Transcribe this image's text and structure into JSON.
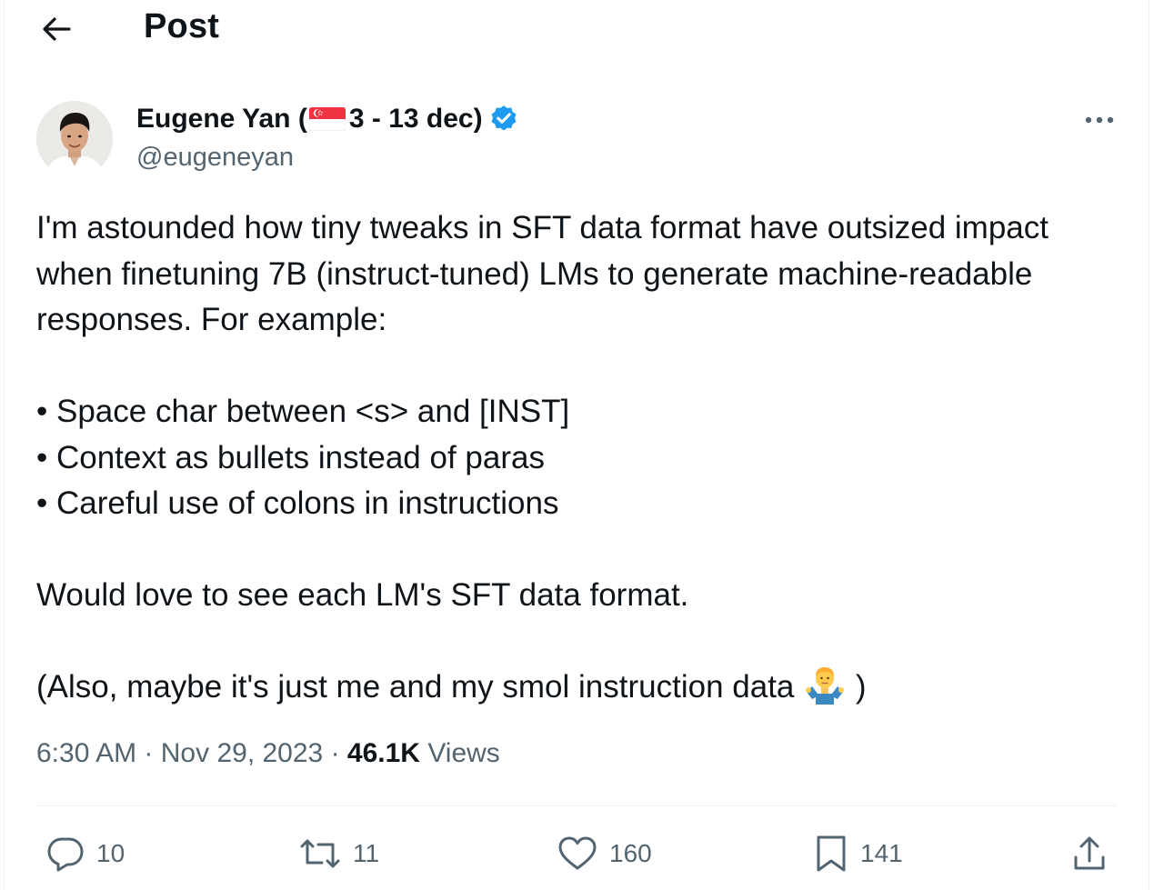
{
  "header": {
    "back_icon": "arrow-left-icon",
    "title": "Post"
  },
  "author": {
    "name_prefix": "Eugene Yan (",
    "flag_icon": "singapore-flag-icon",
    "name_suffix": "3 - 13 dec)",
    "verified_icon": "verified-badge-icon",
    "handle": "@eugeneyan",
    "more_icon": "more-options-icon"
  },
  "tweet": {
    "lines": [
      "I'm astounded how tiny tweaks in SFT data format have outsized impact",
      "when finetuning 7B (instruct-tuned) LMs to generate machine-readable",
      "responses. For example:"
    ],
    "bullets": [
      "• Space char between <s> and [INST]",
      "• Context as bullets instead of paras",
      "• Careful use of colons in instructions"
    ],
    "closing": "Would love to see each LM's SFT data format.",
    "aside_prefix": "(Also, maybe it's just me and my smol instruction data",
    "aside_emoji": "man-shrugging-emoji",
    "aside_suffix": ")"
  },
  "meta": {
    "time": "6:30 AM",
    "separator": "·",
    "date": "Nov 29, 2023",
    "views_count": "46.1K",
    "views_label": "Views"
  },
  "actions": {
    "replies": "10",
    "reposts": "11",
    "likes": "160",
    "bookmarks": "141"
  },
  "colors": {
    "text": "#0f1419",
    "secondary": "#536471",
    "verified": "#1d9bf0",
    "divider": "#eff3f4"
  }
}
